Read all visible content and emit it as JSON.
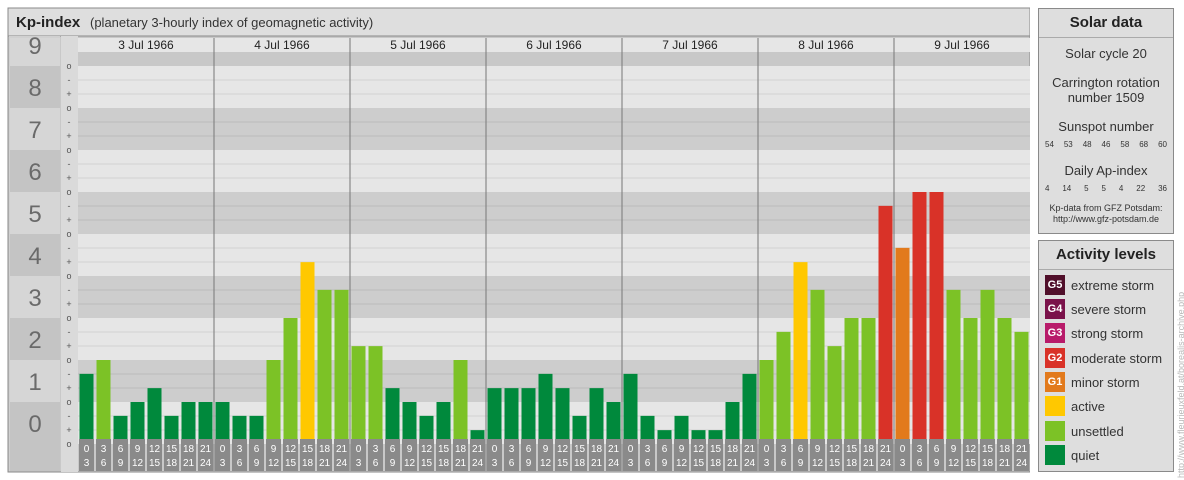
{
  "header": {
    "title": "Kp-index",
    "subtitle": "(planetary 3-hourly index of geomagnetic activity)"
  },
  "watermark": "http://www.fleurieuxfeld.at/borealis-archive.php",
  "solar_data": {
    "title": "Solar data",
    "cycle": "Solar cycle 20",
    "carrington": "Carrington rotation number 1509",
    "sunspot_label": "Sunspot number",
    "sunspot_values": [
      "54",
      "53",
      "48",
      "46",
      "58",
      "68",
      "60"
    ],
    "ap_label": "Daily Ap-index",
    "ap_values": [
      "4",
      "14",
      "5",
      "5",
      "4",
      "22",
      "36"
    ],
    "source_line1": "Kp-data from GFZ Potsdam:",
    "source_line2": "http://www.gfz-potsdam.de"
  },
  "activity_levels": {
    "title": "Activity levels",
    "items": [
      {
        "code": "G5",
        "label": "extreme storm",
        "color": "#500f2a"
      },
      {
        "code": "G4",
        "label": "severe storm",
        "color": "#7a124a"
      },
      {
        "code": "G3",
        "label": "strong storm",
        "color": "#b81b6a"
      },
      {
        "code": "G2",
        "label": "moderate storm",
        "color": "#d93228"
      },
      {
        "code": "G1",
        "label": "minor storm",
        "color": "#e27a1c"
      },
      {
        "code": "",
        "label": "active",
        "color": "#ffc800"
      },
      {
        "code": "",
        "label": "unsettled",
        "color": "#7cc226"
      },
      {
        "code": "",
        "label": "quiet",
        "color": "#00893c"
      }
    ]
  },
  "chart_data": {
    "type": "bar",
    "title": "Kp-index",
    "y_ticks": [
      "0",
      "1",
      "2",
      "3",
      "4",
      "5",
      "6",
      "7",
      "8",
      "9"
    ],
    "ylim": [
      0,
      9
    ],
    "sub_ticks": [
      "+",
      "-",
      "o"
    ],
    "days": [
      "3 Jul 1966",
      "4 Jul 1966",
      "5 Jul 1966",
      "6 Jul 1966",
      "7 Jul 1966",
      "8 Jul 1966",
      "9 Jul 1966"
    ],
    "interval_starts": [
      "0",
      "3",
      "6",
      "9",
      "12",
      "15",
      "18",
      "21"
    ],
    "interval_ends": [
      "3",
      "6",
      "9",
      "12",
      "15",
      "18",
      "21",
      "24"
    ],
    "values": [
      1.67,
      2.0,
      0.67,
      1.0,
      1.33,
      0.67,
      1.0,
      1.0,
      1.0,
      0.67,
      0.67,
      2.0,
      3.0,
      4.33,
      3.67,
      3.67,
      2.33,
      2.33,
      1.33,
      1.0,
      0.67,
      1.0,
      2.0,
      0.33,
      1.33,
      1.33,
      1.33,
      1.67,
      1.33,
      0.67,
      1.33,
      1.0,
      1.67,
      0.67,
      0.33,
      0.67,
      0.33,
      0.33,
      1.0,
      1.67,
      2.0,
      2.67,
      4.33,
      3.67,
      2.33,
      3.0,
      3.0,
      5.67,
      4.67,
      6.0,
      6.0,
      3.67,
      3.0,
      3.67,
      3.0,
      2.67
    ],
    "colors": {
      "quiet": "#00893c",
      "unsettled": "#7cc226",
      "active": "#ffc800",
      "g1": "#e27a1c",
      "g2": "#d93228"
    }
  }
}
